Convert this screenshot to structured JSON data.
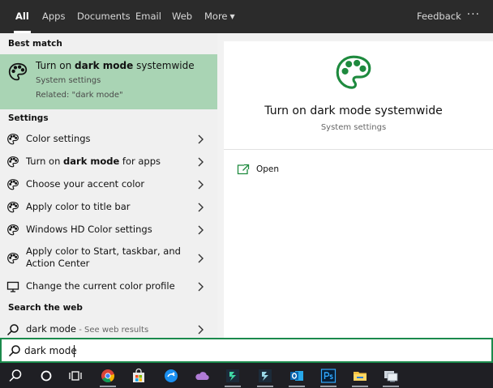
{
  "tabs": [
    {
      "label": "All",
      "active": true
    },
    {
      "label": "Apps"
    },
    {
      "label": "Documents"
    },
    {
      "label": "Email"
    },
    {
      "label": "Web"
    },
    {
      "label": "More",
      "dropdown": true
    }
  ],
  "header": {
    "feedback": "Feedback",
    "more_options": "···"
  },
  "best_match": {
    "heading": "Best match",
    "title_prefix": "Turn on ",
    "title_bold": "dark mode",
    "title_suffix": " systemwide",
    "subtitle": "System settings",
    "related": "Related: \"dark mode\"",
    "icon": "palette-icon"
  },
  "settings": {
    "heading": "Settings",
    "items": [
      {
        "label": "Color settings",
        "icon": "palette-icon"
      },
      {
        "prefix": "Turn on ",
        "bold": "dark mode",
        "suffix": " for apps",
        "icon": "palette-icon"
      },
      {
        "label": "Choose your accent color",
        "icon": "palette-icon"
      },
      {
        "label": "Apply color to title bar",
        "icon": "palette-icon"
      },
      {
        "label": "Windows HD Color settings",
        "icon": "palette-icon"
      },
      {
        "line1": "Apply color to Start, taskbar, and",
        "line2": "Action Center",
        "icon": "palette-icon"
      },
      {
        "label": "Change the current color profile",
        "icon": "monitor-icon"
      }
    ]
  },
  "web": {
    "heading": "Search the web",
    "query": "dark mode",
    "hint": " - See web results"
  },
  "preview": {
    "title": "Turn on dark mode systemwide",
    "subtitle": "System settings",
    "open_label": "Open",
    "accent": "#1e8a3e"
  },
  "search": {
    "value": "dark mode"
  },
  "taskbar": [
    "search-icon",
    "cortana-icon",
    "task-view-icon",
    "chrome-icon",
    "store-icon",
    "app-icon",
    "onedrive-icon",
    "filmora-icon",
    "filmora-icon",
    "outlook-icon",
    "photoshop-icon",
    "file-explorer-icon",
    "remote-desktop-icon"
  ],
  "colors": {
    "topbar": "#2b2b2b",
    "highlight": "#a9d4b4",
    "search_border": "#1b8a4c",
    "taskbar": "#1f1f24"
  }
}
